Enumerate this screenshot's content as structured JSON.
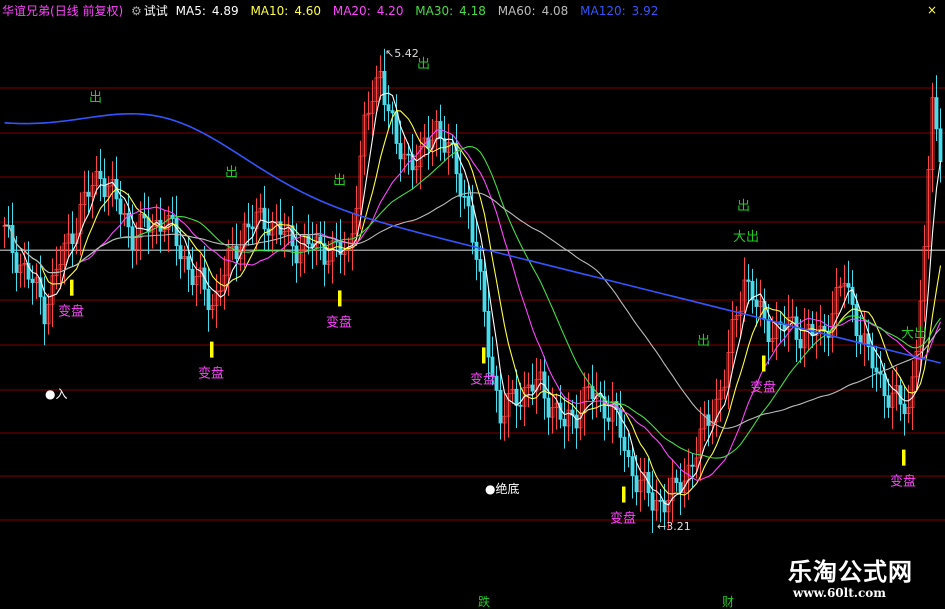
{
  "header": {
    "title": "华谊兄弟",
    "period": "(日线 前复权)",
    "indicator": "试试",
    "ma": [
      {
        "label": "MA5:",
        "value": "4.89",
        "color": "#ffffff"
      },
      {
        "label": "MA10:",
        "value": "4.60",
        "color": "#ffff44"
      },
      {
        "label": "MA20:",
        "value": "4.20",
        "color": "#ff44ff"
      },
      {
        "label": "MA30:",
        "value": "4.18",
        "color": "#44dd44"
      },
      {
        "label": "MA60:",
        "value": "4.08",
        "color": "#bbbbbb"
      },
      {
        "label": "MA120:",
        "value": "3.92",
        "color": "#3355ff"
      }
    ],
    "close_glyph": "×"
  },
  "colors": {
    "up": "#ff4444",
    "down": "#44ddee",
    "sell_label": "#22cc22",
    "change_label": "#ff44ff",
    "marker": "#ffff00",
    "price_line": "#c8c8c8",
    "grid": "#800000"
  },
  "chart_data": {
    "type": "candlestick",
    "price_high_label": "5.42",
    "price_low_label": "3.21",
    "reference_price": 4.47,
    "y_range": [
      3.05,
      5.55
    ],
    "ma_values_last": {
      "MA5": 4.89,
      "MA10": 4.6,
      "MA20": 4.2,
      "MA30": 4.18,
      "MA60": 4.08,
      "MA120": 3.92
    },
    "signals": [
      {
        "text": "出",
        "kind": "sell",
        "bar": 23
      },
      {
        "text": "出",
        "kind": "sell",
        "bar": 57
      },
      {
        "text": "出",
        "kind": "sell",
        "bar": 84
      },
      {
        "text": "出",
        "kind": "sell",
        "bar": 105
      },
      {
        "text": "出",
        "kind": "sell",
        "bar": 175
      },
      {
        "text": "出",
        "kind": "sell",
        "bar": 185
      },
      {
        "text": "大出",
        "kind": "sell",
        "bar": 184
      },
      {
        "text": "大出",
        "kind": "sell",
        "bar": 226
      },
      {
        "text": "变盘",
        "kind": "change",
        "bar": 17
      },
      {
        "text": "变盘",
        "kind": "change",
        "bar": 52
      },
      {
        "text": "变盘",
        "kind": "change",
        "bar": 84
      },
      {
        "text": "变盘",
        "kind": "change",
        "bar": 120
      },
      {
        "text": "变盘",
        "kind": "change",
        "bar": 155
      },
      {
        "text": "变盘",
        "kind": "change",
        "bar": 190
      },
      {
        "text": "变盘",
        "kind": "change",
        "bar": 225
      },
      {
        "text": "入",
        "kind": "buy",
        "bar": 12
      },
      {
        "text": "绝底",
        "kind": "bottom",
        "bar": 122
      }
    ],
    "x_ticks": [
      "跌",
      "财"
    ]
  },
  "watermark": {
    "title": "乐淘公式网",
    "url": "www.60lt.com"
  }
}
